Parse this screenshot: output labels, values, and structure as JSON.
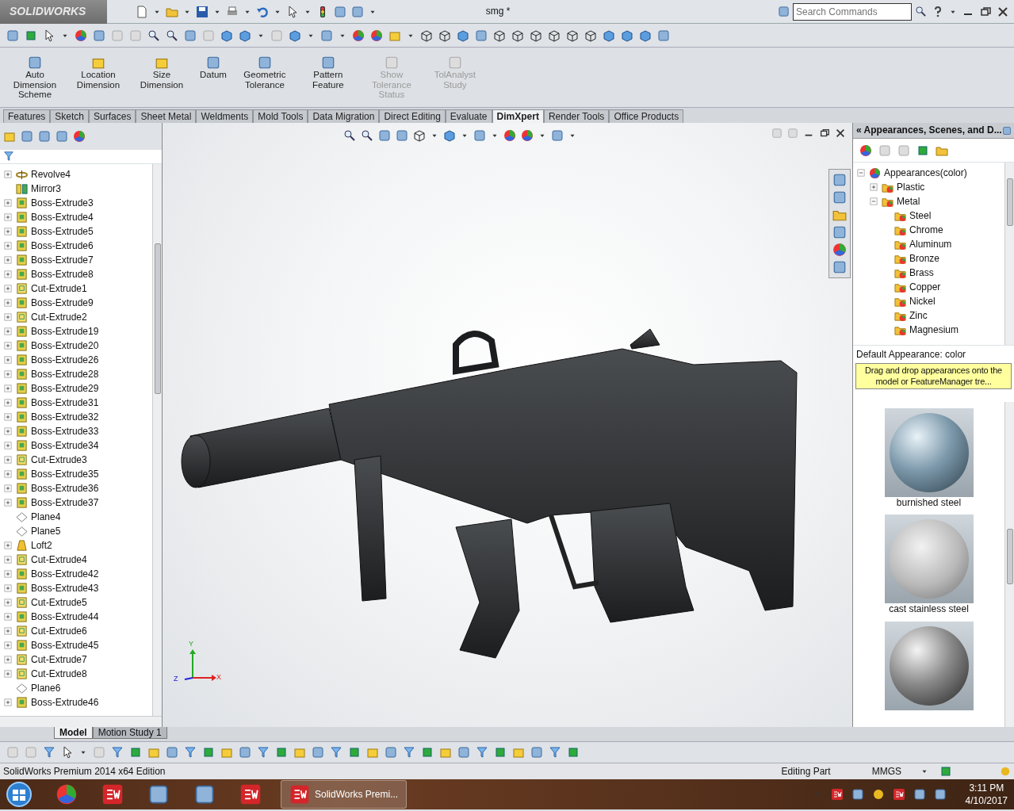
{
  "titlebar": {
    "logo": "SOLIDWORKS",
    "title": "smg *",
    "search": {
      "placeholder": "Search Commands"
    }
  },
  "commands": [
    {
      "label": "Auto Dimension Scheme",
      "disabled": false
    },
    {
      "label": "Location Dimension",
      "disabled": false
    },
    {
      "label": "Size Dimension",
      "disabled": false
    },
    {
      "label": "Datum",
      "disabled": false
    },
    {
      "label": "Geometric Tolerance",
      "disabled": false
    },
    {
      "label": "Pattern Feature",
      "disabled": false
    },
    {
      "label": "Show Tolerance Status",
      "disabled": true
    },
    {
      "label": "TolAnalyst Study",
      "disabled": true
    }
  ],
  "tabs": [
    {
      "label": "Features",
      "selected": false
    },
    {
      "label": "Sketch",
      "selected": false
    },
    {
      "label": "Surfaces",
      "selected": false
    },
    {
      "label": "Sheet Metal",
      "selected": false
    },
    {
      "label": "Weldments",
      "selected": false
    },
    {
      "label": "Mold Tools",
      "selected": false
    },
    {
      "label": "Data Migration",
      "selected": false
    },
    {
      "label": "Direct Editing",
      "selected": false
    },
    {
      "label": "Evaluate",
      "selected": false
    },
    {
      "label": "DimXpert",
      "selected": true
    },
    {
      "label": "Render Tools",
      "selected": false
    },
    {
      "label": "Office Products",
      "selected": false
    }
  ],
  "feature_tree": [
    {
      "label": "Revolve4",
      "kind": "revolve",
      "expandable": true
    },
    {
      "label": "Mirror3",
      "kind": "mirror",
      "expandable": false
    },
    {
      "label": "Boss-Extrude3",
      "kind": "extrude",
      "expandable": true
    },
    {
      "label": "Boss-Extrude4",
      "kind": "extrude",
      "expandable": true
    },
    {
      "label": "Boss-Extrude5",
      "kind": "extrude",
      "expandable": true
    },
    {
      "label": "Boss-Extrude6",
      "kind": "extrude",
      "expandable": true
    },
    {
      "label": "Boss-Extrude7",
      "kind": "extrude",
      "expandable": true
    },
    {
      "label": "Boss-Extrude8",
      "kind": "extrude",
      "expandable": true
    },
    {
      "label": "Cut-Extrude1",
      "kind": "cut",
      "expandable": true
    },
    {
      "label": "Boss-Extrude9",
      "kind": "extrude",
      "expandable": true
    },
    {
      "label": "Cut-Extrude2",
      "kind": "cut",
      "expandable": true
    },
    {
      "label": "Boss-Extrude19",
      "kind": "extrude",
      "expandable": true
    },
    {
      "label": "Boss-Extrude20",
      "kind": "extrude",
      "expandable": true
    },
    {
      "label": "Boss-Extrude26",
      "kind": "extrude",
      "expandable": true
    },
    {
      "label": "Boss-Extrude28",
      "kind": "extrude",
      "expandable": true
    },
    {
      "label": "Boss-Extrude29",
      "kind": "extrude",
      "expandable": true
    },
    {
      "label": "Boss-Extrude31",
      "kind": "extrude",
      "expandable": true
    },
    {
      "label": "Boss-Extrude32",
      "kind": "extrude",
      "expandable": true
    },
    {
      "label": "Boss-Extrude33",
      "kind": "extrude",
      "expandable": true
    },
    {
      "label": "Boss-Extrude34",
      "kind": "extrude",
      "expandable": true
    },
    {
      "label": "Cut-Extrude3",
      "kind": "cut",
      "expandable": true
    },
    {
      "label": "Boss-Extrude35",
      "kind": "extrude",
      "expandable": true
    },
    {
      "label": "Boss-Extrude36",
      "kind": "extrude",
      "expandable": true
    },
    {
      "label": "Boss-Extrude37",
      "kind": "extrude",
      "expandable": true
    },
    {
      "label": "Plane4",
      "kind": "plane",
      "expandable": false
    },
    {
      "label": "Plane5",
      "kind": "plane",
      "expandable": false
    },
    {
      "label": "Loft2",
      "kind": "loft",
      "expandable": true
    },
    {
      "label": "Cut-Extrude4",
      "kind": "cut",
      "expandable": true
    },
    {
      "label": "Boss-Extrude42",
      "kind": "extrude",
      "expandable": true
    },
    {
      "label": "Boss-Extrude43",
      "kind": "extrude",
      "expandable": true
    },
    {
      "label": "Cut-Extrude5",
      "kind": "cut",
      "expandable": true
    },
    {
      "label": "Boss-Extrude44",
      "kind": "extrude",
      "expandable": true
    },
    {
      "label": "Cut-Extrude6",
      "kind": "cut",
      "expandable": true
    },
    {
      "label": "Boss-Extrude45",
      "kind": "extrude",
      "expandable": true
    },
    {
      "label": "Cut-Extrude7",
      "kind": "cut",
      "expandable": true
    },
    {
      "label": "Cut-Extrude8",
      "kind": "cut",
      "expandable": true
    },
    {
      "label": "Plane6",
      "kind": "plane",
      "expandable": false
    },
    {
      "label": "Boss-Extrude46",
      "kind": "extrude",
      "expandable": true
    }
  ],
  "triad": {
    "y": "Y",
    "z": "Z",
    "x": "X"
  },
  "task_pane": {
    "title": "« Appearances, Scenes, and D...",
    "tree": [
      {
        "label": "Appearances(color)",
        "expanded": true,
        "children": [
          {
            "label": "Plastic",
            "expanded": false
          },
          {
            "label": "Metal",
            "expanded": true,
            "children": [
              {
                "label": "Steel"
              },
              {
                "label": "Chrome"
              },
              {
                "label": "Aluminum"
              },
              {
                "label": "Bronze"
              },
              {
                "label": "Brass"
              },
              {
                "label": "Copper"
              },
              {
                "label": "Nickel"
              },
              {
                "label": "Zinc"
              },
              {
                "label": "Magnesium"
              }
            ]
          }
        ]
      }
    ],
    "default_appearance": "Default Appearance: color",
    "hint": "Drag and drop appearances onto the model or FeatureManager tre...",
    "previews": [
      {
        "label": "burnished steel",
        "kind": "glossy"
      },
      {
        "label": "cast stainless steel",
        "kind": "speckled"
      },
      {
        "kind": "glossy"
      }
    ]
  },
  "bottom_tabs": [
    {
      "label": "Model",
      "selected": true
    },
    {
      "label": "Motion Study 1",
      "selected": false
    }
  ],
  "status_bar": {
    "edition": "SolidWorks Premium 2014 x64 Edition",
    "mode": "Editing Part",
    "units": "MMGS"
  },
  "taskbar": {
    "active_window": "SolidWorks Premi...",
    "time": "3:11 PM",
    "date": "4/10/2017"
  }
}
